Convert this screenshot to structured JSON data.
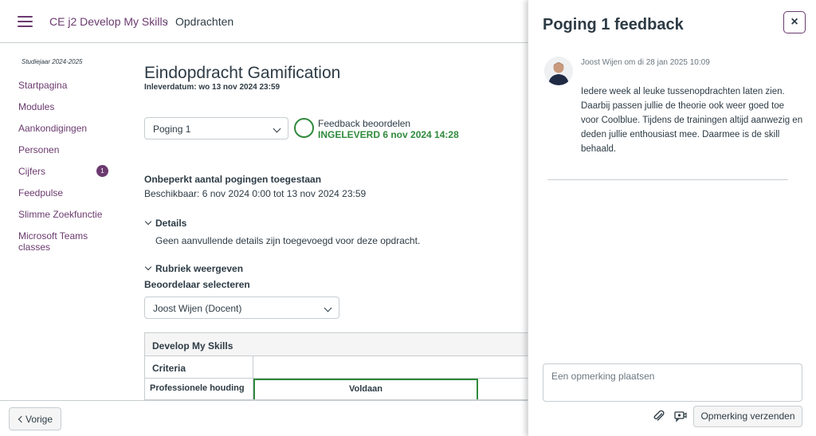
{
  "breadcrumb": {
    "course": "CE j2 Develop My Skills",
    "separator": "›",
    "page": "Opdrachten"
  },
  "sidebar": {
    "term": "Studiejaar 2024-2025",
    "items": [
      {
        "label": "Startpagina"
      },
      {
        "label": "Modules"
      },
      {
        "label": "Aankondigingen"
      },
      {
        "label": "Personen"
      },
      {
        "label": "Cijfers",
        "badge": "1"
      },
      {
        "label": "Feedpulse"
      },
      {
        "label": "Slimme Zoekfunctie"
      },
      {
        "label": "Microsoft Teams classes"
      }
    ]
  },
  "assignment": {
    "title": "Eindopdracht Gamification",
    "due": "Inleverdatum: wo 13 nov 2024 23:59",
    "attempt_selected": "Poging 1",
    "feedback_link": "Feedback beoordelen",
    "status": "INGELEVERD 6 nov 2024 14:28",
    "attempts_info": "Onbeperkt aantal pogingen toegestaan",
    "availability": "Beschikbaar: 6 nov 2024 0:00 tot 13 nov 2024 23:59",
    "details_toggle": "Details",
    "details_text": "Geen aanvullende details zijn toegevoegd voor deze opdracht.",
    "rubric_toggle": "Rubriek weergeven",
    "grader_label": "Beoordelaar selecteren",
    "grader_selected": "Joost Wijen (Docent)"
  },
  "rubric": {
    "title": "Develop My Skills",
    "criteria_header": "Criteria",
    "rows": [
      {
        "criterion": "Professionele houding",
        "rating": "Voldaan"
      }
    ]
  },
  "footer": {
    "prev_label": "Vorige"
  },
  "tray": {
    "title": "Poging 1 feedback",
    "close_label": "×",
    "comment": {
      "author_line": "Joost Wijen om di 28 jan 2025 10:09",
      "text": "Iedere week al leuke tussenopdrachten laten zien. Daarbij passen jullie de theorie ook weer goed toe voor Coolblue. Tijdens de trainingen altijd aanwezig en deden jullie enthousiast mee. Daarmee is de skill behaald."
    },
    "input_placeholder": "Een opmerking plaatsen",
    "send_label": "Opmerking verzenden",
    "icons": [
      "paperclip-icon",
      "media-comment-icon"
    ]
  },
  "colors": {
    "brand": "#6b3a6f",
    "success": "#2f8a3c",
    "text": "#2d3b45",
    "border": "#c7cdd1"
  }
}
